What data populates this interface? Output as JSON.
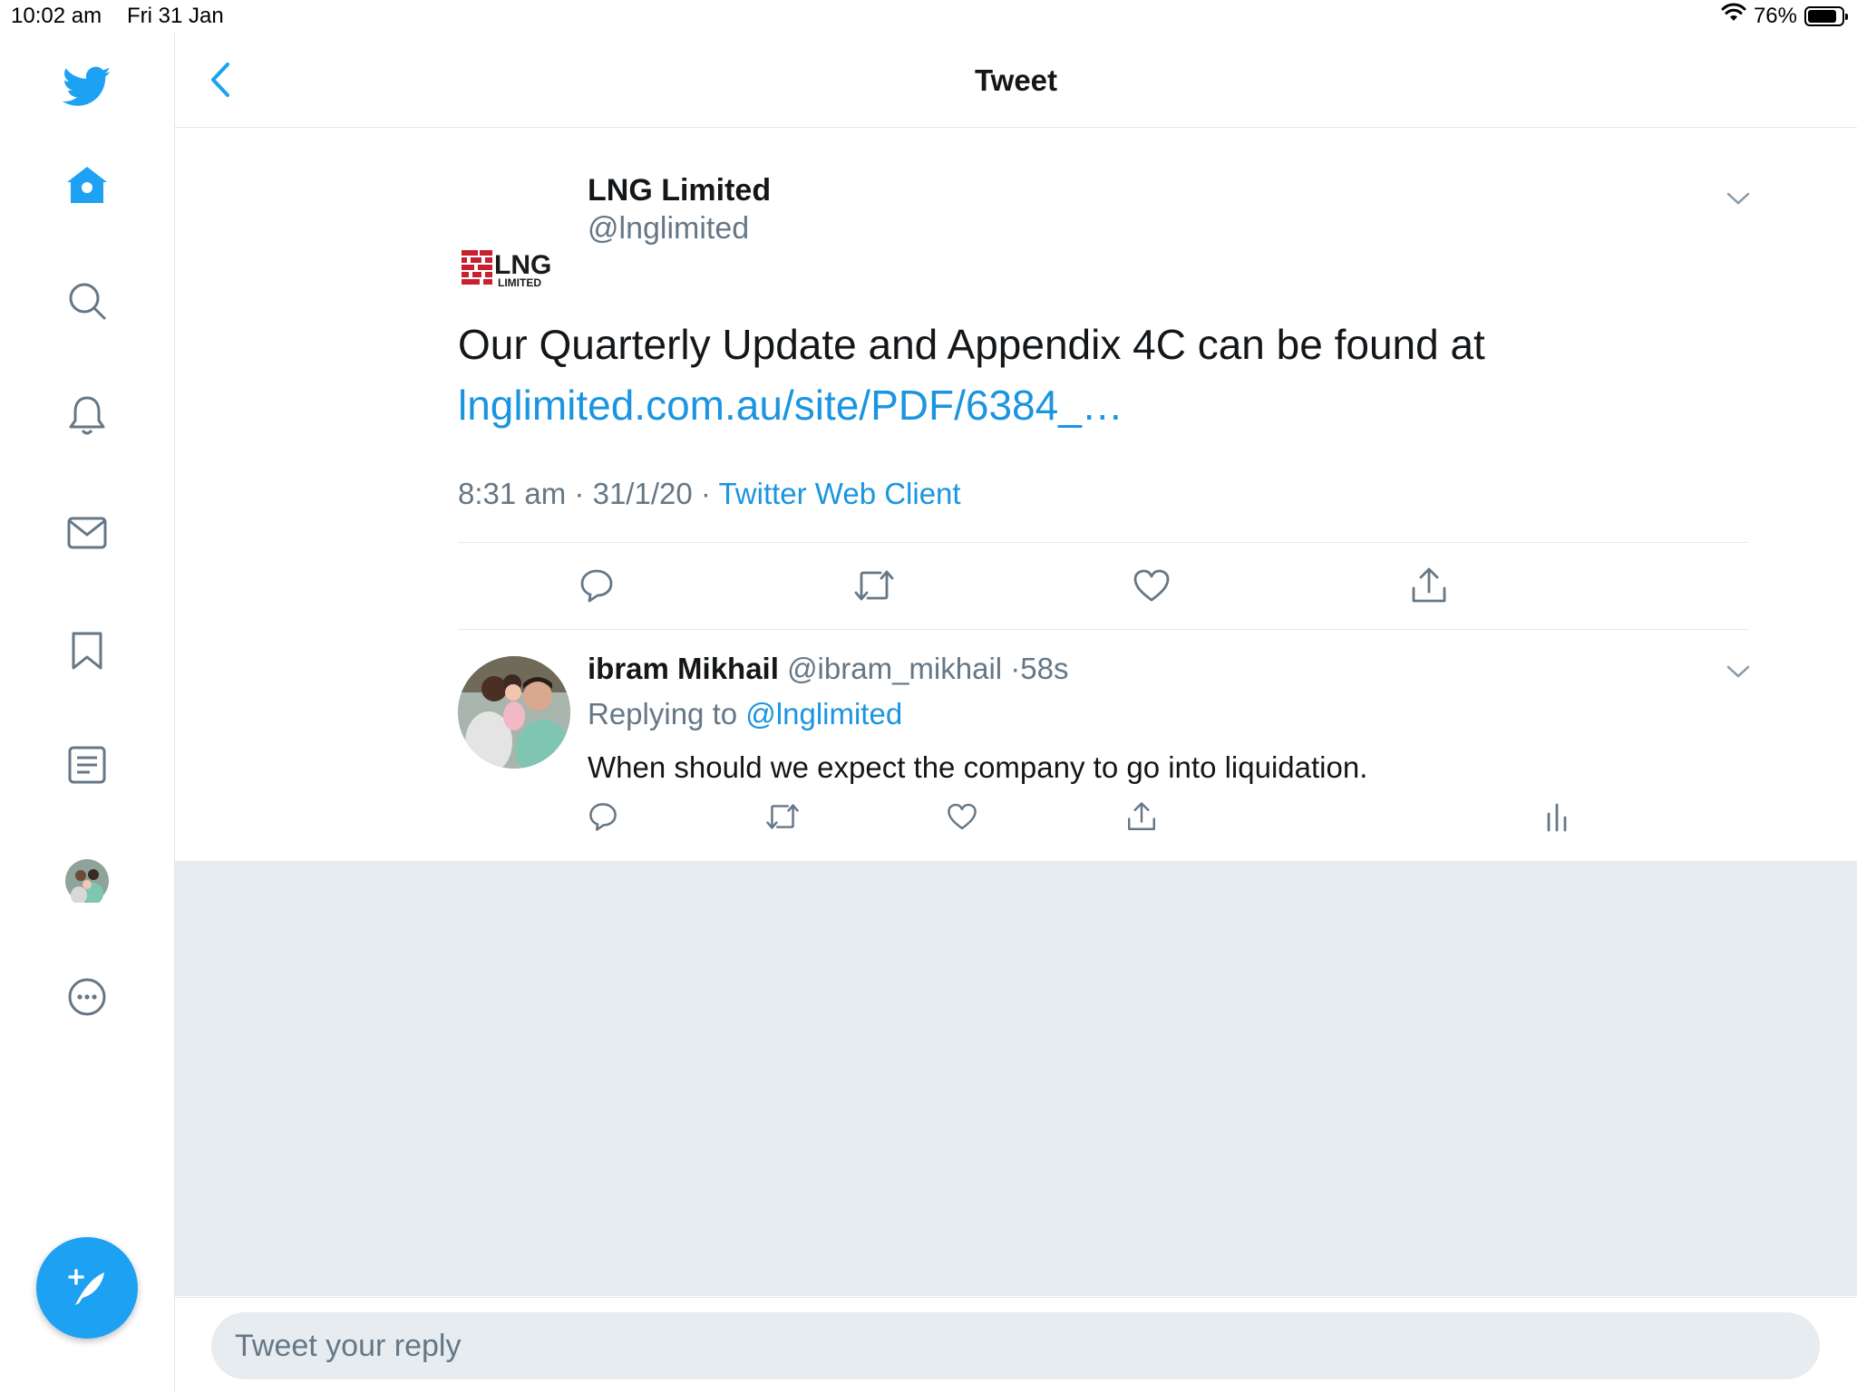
{
  "status_bar": {
    "time": "10:02 am",
    "date": "Fri 31 Jan",
    "battery": "76%"
  },
  "header": {
    "title": "Tweet"
  },
  "tweet": {
    "logo_text": "LNG",
    "logo_subtext": "LIMITED",
    "author_name": "LNG Limited",
    "author_handle": "@lnglimited",
    "text": "Our Quarterly Update and Appendix 4C can be found at",
    "link": "lnglimited.com.au/site/PDF/6384_…",
    "time": "8:31 am",
    "date": "31/1/20",
    "source": "Twitter Web Client"
  },
  "reply": {
    "name": "ibram Mikhail",
    "handle": "@ibram_mikhail",
    "age": "58s",
    "replying_label": "Replying to",
    "replying_handle": "@lnglimited",
    "text": "When should we expect the company to go into liquidation."
  },
  "composer": {
    "placeholder": "Tweet your reply"
  },
  "colors": {
    "accent": "#1da1f2",
    "link": "#1b95e0",
    "secondary_text": "#657786",
    "background_grey": "#e6ecf0"
  }
}
